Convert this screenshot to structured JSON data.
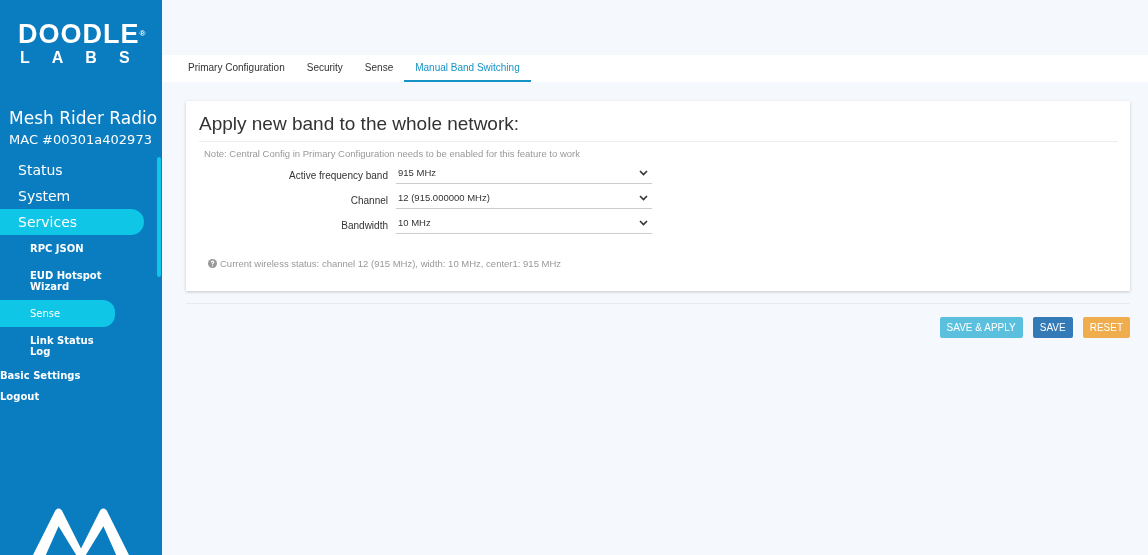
{
  "sidebar": {
    "logo": {
      "line_1": "DOODLE",
      "line_2": "LABS",
      "mark": "®"
    },
    "device_name": "Mesh Rider Radio",
    "mac": "MAC #00301a402973",
    "items": [
      {
        "label": "Status",
        "kind": "main",
        "selected": false
      },
      {
        "label": "System",
        "kind": "main",
        "selected": false
      },
      {
        "label": "Services",
        "kind": "main",
        "selected": true
      },
      {
        "label": "RPC JSON",
        "kind": "sub",
        "selected": false
      },
      {
        "label": "EUD Hotspot Wizard",
        "kind": "sub",
        "selected": false
      },
      {
        "label": "Sense",
        "kind": "sub",
        "selected": true
      },
      {
        "label": "Link Status Log",
        "kind": "sub",
        "selected": false
      },
      {
        "label": "Basic Settings",
        "kind": "top",
        "selected": false
      },
      {
        "label": "Logout",
        "kind": "top",
        "selected": false
      }
    ]
  },
  "tabs": [
    {
      "label": "Primary Configuration",
      "selected": false
    },
    {
      "label": "Security",
      "selected": false
    },
    {
      "label": "Sense",
      "selected": false
    },
    {
      "label": "Manual Band Switching",
      "selected": true
    }
  ],
  "card": {
    "title": "Apply new band to the whole network:",
    "note": "Note: Central Config in Primary Configuration needs to be enabled for this feature to work",
    "fields": [
      {
        "label": "Active frequency band",
        "value": "915 MHz"
      },
      {
        "label": "Channel",
        "value": "12 (915.000000 MHz)"
      },
      {
        "label": "Bandwidth",
        "value": "10 MHz"
      }
    ],
    "status": "Current wireless status: channel 12 (915 MHz), width: 10 MHz, center1: 915 MHz"
  },
  "buttons": [
    {
      "label": "SAVE & APPLY",
      "kind": "apply"
    },
    {
      "label": "SAVE",
      "kind": "save"
    },
    {
      "label": "RESET",
      "kind": "reset"
    }
  ]
}
